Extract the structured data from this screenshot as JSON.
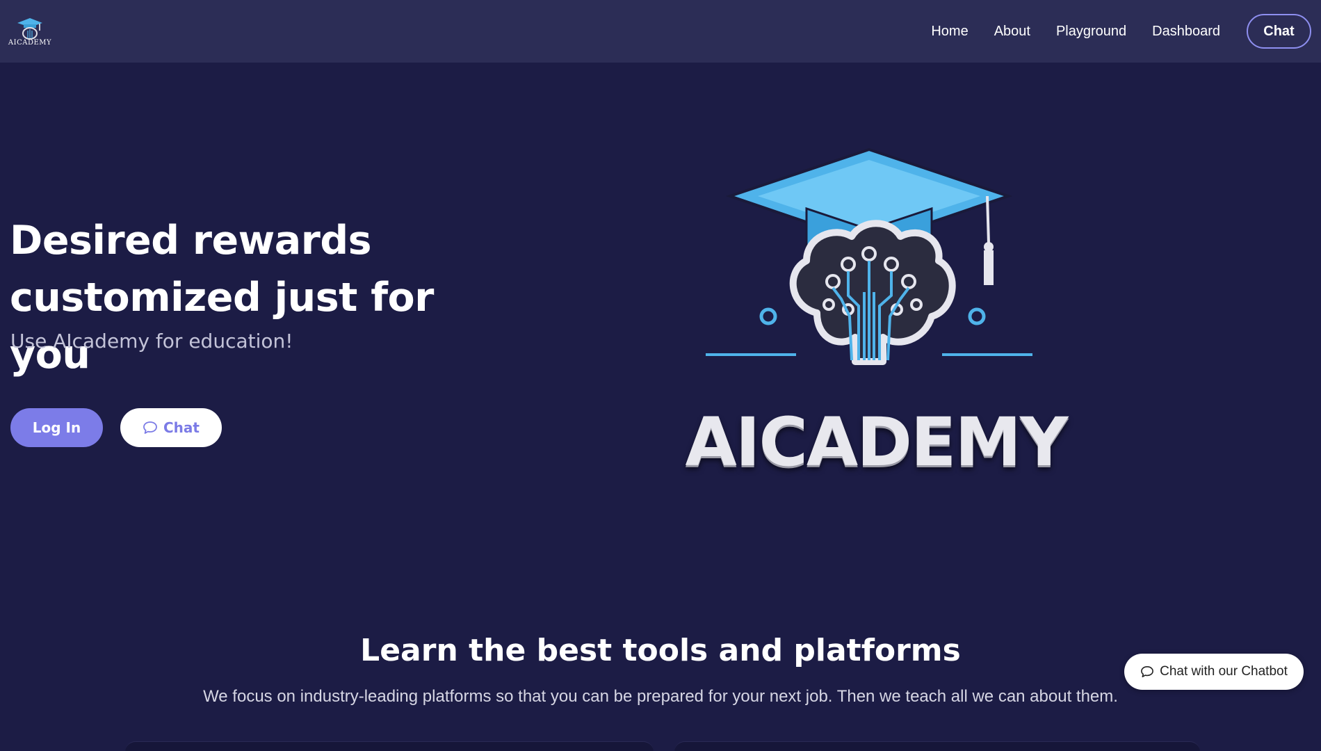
{
  "brand": {
    "logo_text": "AICADEMY"
  },
  "nav": {
    "links": [
      "Home",
      "About",
      "Playground",
      "Dashboard"
    ],
    "chat_label": "Chat"
  },
  "hero": {
    "title_line1": "Desired rewards",
    "title_line2": "customized just for you",
    "subtitle": "Use AIcademy for education!",
    "login_label": "Log In",
    "chat_label": "Chat",
    "logo_wordmark": "AICADEMY"
  },
  "section": {
    "title": "Learn the best tools and platforms",
    "subtitle": "We focus on industry-leading platforms so that you can be prepared for your next job. Then we teach all we can about them."
  },
  "chatbot": {
    "label": "Chat with our Chatbot"
  },
  "colors": {
    "background": "#1c1c45",
    "navbar": "#2c2d56",
    "accent": "#7c7ce8",
    "logo_cap": "#4fb3ea"
  }
}
